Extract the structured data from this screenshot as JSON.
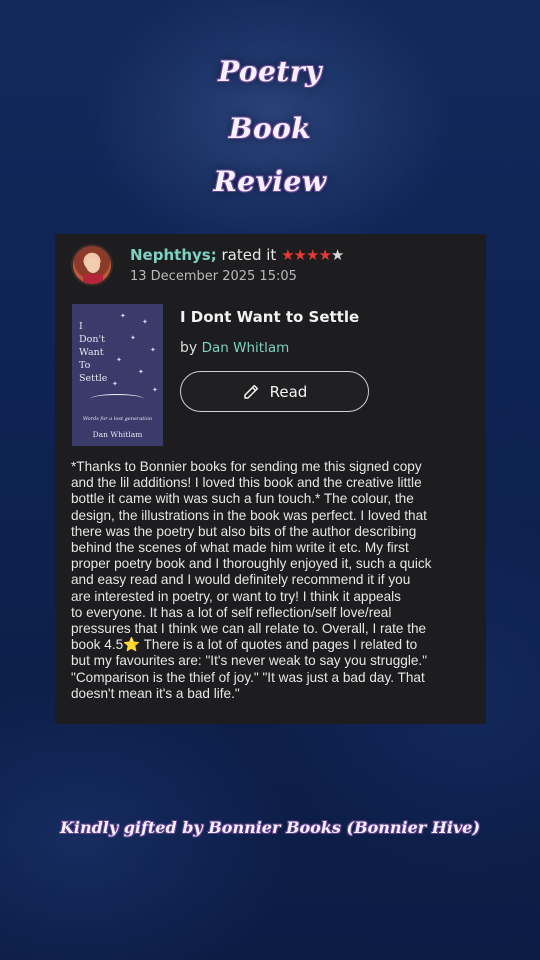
{
  "header": {
    "title_lines": [
      "Poetry",
      "Book",
      "Review"
    ]
  },
  "review_card": {
    "user_name": "Nephthys;",
    "rated_text": "rated it",
    "rating": {
      "filled_stars": 4,
      "total_stars": 5,
      "star_color": "#e53935"
    },
    "date": "13 December 2025 15:05",
    "book": {
      "title": "I Dont Want to Settle",
      "by_label": "by",
      "author": "Dan Whitlam",
      "cover": {
        "title_text": "I\nDon't\nWant\nTo\nSettle",
        "subtitle": "Words for a lost generation",
        "author": "Dan Whitlam",
        "color": "#3b3b6b"
      }
    },
    "read_button_label": "Read",
    "review_lines": [
      "*Thanks to Bonnier books for sending me this signed copy",
      "and the lil additions! I loved this book and the creative little",
      "bottle it came with was such a fun touch.* The colour, the",
      "design, the illustrations in the book was perfect. I loved that",
      "there was the poetry but also bits of the author describing",
      "behind the scenes of what made him write it etc. My first",
      "proper poetry book and I thoroughly enjoyed it, such a quick",
      "and easy read and I would definitely recommend it if you",
      "are interested in poetry, or want to try! I think it appeals",
      "to everyone. It has a lot of self reflection/self love/real",
      "pressures that I think we can all relate to. Overall, I rate the",
      "book 4.5⭐ There is a lot of quotes and pages I related to",
      "but my favourites are: \"It's never weak to say you struggle.\"",
      "\"Comparison is the thief of joy.\" \"It was just a bad day. That",
      "doesn't mean it's a bad life.\""
    ]
  },
  "footer": {
    "text": "Kindly gifted by Bonnier Books (Bonnier Hive)"
  },
  "colors": {
    "background": "#0e1f4a",
    "card": "#1d1d1f",
    "accent_teal": "#7fd0c0"
  }
}
